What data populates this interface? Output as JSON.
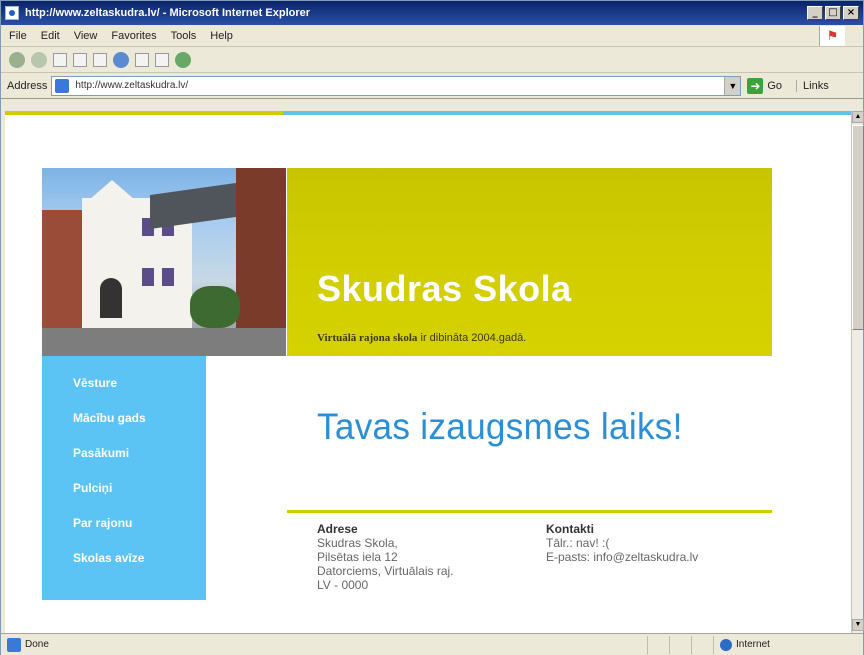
{
  "browser": {
    "title": "http://www.zeltaskudra.lv/ - Microsoft Internet Explorer",
    "menu": [
      "File",
      "Edit",
      "View",
      "Favorites",
      "Tools",
      "Help"
    ],
    "address_label": "Address",
    "address_value": "http://www.zeltaskudra.lv/",
    "go_label": "Go",
    "links_label": "Links",
    "status_text": "Done",
    "zone_label": "Internet"
  },
  "site": {
    "title": "Skudras Skola",
    "tagline_bold": "Virtuālā rajona skola",
    "tagline_rest": " ir dibināta 2004.gadā.",
    "slogan": "Tavas izaugsmes laiks!",
    "nav": [
      "Vēsture",
      "Mācību gads",
      "Pasākumi",
      "Pulciņi",
      "Par rajonu",
      "Skolas avīze"
    ],
    "address": {
      "heading": "Adrese",
      "lines": [
        "Skudras Skola,",
        "Pilsētas iela 12",
        "Datorciems, Virtuālais raj.",
        "LV - 0000"
      ]
    },
    "contacts": {
      "heading": "Kontakti",
      "phone": "Tālr.: nav! :(",
      "email": "E-pasts: info@zeltaskudra.lv"
    }
  },
  "colors": {
    "banner_yellow": "#d0cc00",
    "nav_blue": "#5bc4f5",
    "slogan_blue": "#2a8fd6"
  }
}
